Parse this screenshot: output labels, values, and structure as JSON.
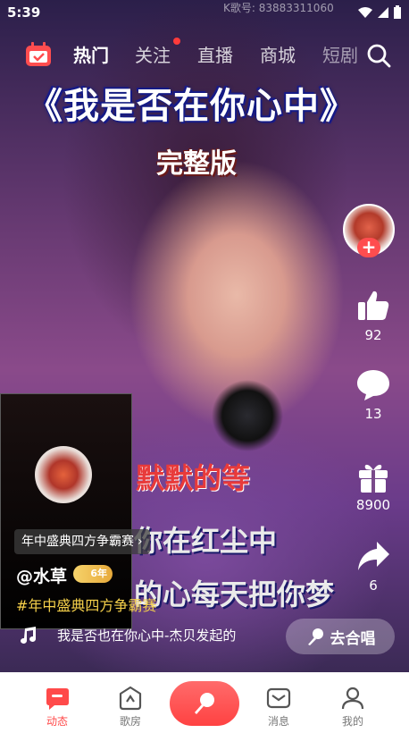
{
  "status_bar": {
    "time": "5:39",
    "watermark": "K歌号: 83883311060"
  },
  "top_nav": {
    "tabs": [
      {
        "label": "热门",
        "active": true
      },
      {
        "label": "关注",
        "has_dot": true
      },
      {
        "label": "直播"
      },
      {
        "label": "商城"
      },
      {
        "label": "短剧"
      }
    ]
  },
  "video": {
    "title_line1": "《我是否在你心中》",
    "title_line2": "完整版",
    "lyrics": [
      "默默的等",
      "你在红尘中",
      "的心每天把你梦"
    ]
  },
  "actions": {
    "likes": "92",
    "comments": "13",
    "gifts": "8900",
    "shares": "6",
    "follow_symbol": "+"
  },
  "post": {
    "challenge": "年中盛典四方争霸赛",
    "username": "@水草",
    "badge": "6年",
    "hashtag": "#年中盛典四方争霸赛",
    "music": "我是否也在你心中-杰贝发起的",
    "chorus_button": "去合唱"
  },
  "bottom_nav": {
    "items": [
      {
        "label": "动态",
        "active": true
      },
      {
        "label": "歌房"
      },
      {
        "label": "消息"
      },
      {
        "label": "我的"
      }
    ]
  },
  "colors": {
    "accent": "#ff4a4a",
    "hashtag": "#f5d04a"
  }
}
